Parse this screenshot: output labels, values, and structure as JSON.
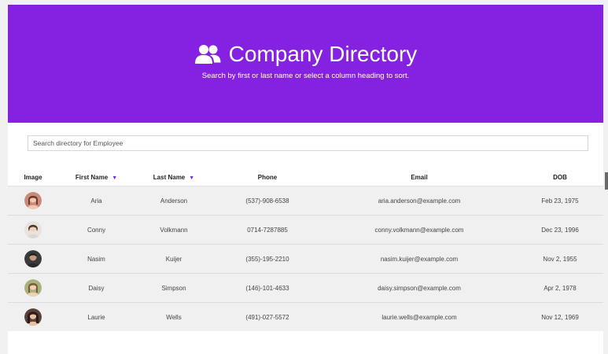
{
  "header": {
    "title": "Company Directory",
    "subtitle": "Search by first or last name or select a column heading to sort.",
    "icon": "users-icon"
  },
  "search": {
    "placeholder": "Search directory for Employee",
    "value": ""
  },
  "table": {
    "columns": [
      "Image",
      "First Name",
      "Last Name",
      "Phone",
      "Email",
      "DOB"
    ],
    "sortable_columns": [
      "First Name",
      "Last Name"
    ],
    "sort_icon": "triangle-down-icon",
    "rows": [
      {
        "first": "Aria",
        "last": "Anderson",
        "phone": "(537)-908-6538",
        "email": "aria.anderson@example.com",
        "dob": "Feb 23, 1975",
        "avatar_color": "#c98a7a",
        "avatar_hair": "#6b3a2e"
      },
      {
        "first": "Conny",
        "last": "Volkmann",
        "phone": "0714-7287885",
        "email": "conny.volkmann@example.com",
        "dob": "Dec 23, 1996",
        "avatar_color": "#e9e3dc",
        "avatar_hair": "#4a3a30"
      },
      {
        "first": "Nasim",
        "last": "Kuijer",
        "phone": "(355)-195-2210",
        "email": "nasim.kuijer@example.com",
        "dob": "Nov 2, 1955",
        "avatar_color": "#3a3a3a",
        "avatar_hair": "#1e1e1e"
      },
      {
        "first": "Daisy",
        "last": "Simpson",
        "phone": "(146)-101-4633",
        "email": "daisy.simpson@example.com",
        "dob": "Apr 2, 1978",
        "avatar_color": "#a8b27a",
        "avatar_hair": "#7a5a3a"
      },
      {
        "first": "Laurie",
        "last": "Wells",
        "phone": "(491)-027-5572",
        "email": "laurie.wells@example.com",
        "dob": "Nov 12, 1969",
        "avatar_color": "#5a4038",
        "avatar_hair": "#2a1d18"
      }
    ]
  },
  "colors": {
    "header_bg": "#8521e0",
    "row_bg": "#f0f0f0",
    "sort_icon": "#6b2fd6"
  }
}
